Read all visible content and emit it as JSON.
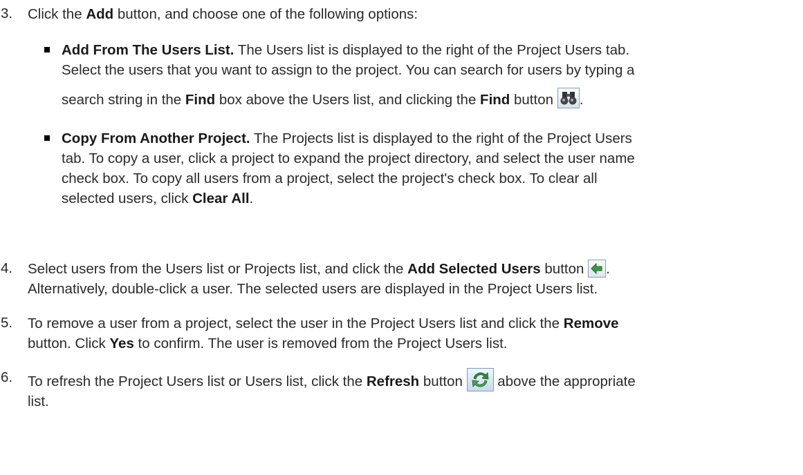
{
  "steps": [
    {
      "number": "3.",
      "intro_1": "Click the ",
      "intro_bold": "Add",
      "intro_2": " button, and choose one of the following options:",
      "options": [
        {
          "title": "Add From The Users List.",
          "line1": " The Users list is displayed to the right of the Project Users tab.",
          "line2": "Select the users that you want to assign to the project. You can search for users by typing a",
          "line3a": "search string in the ",
          "find_bold": "Find",
          "line3b": " box above the Users list, and clicking the ",
          "find_button_bold": "Find",
          "line3c": " button",
          "line3d": "."
        },
        {
          "title": "Copy From Another Project.",
          "line1": " The Projects list is displayed to the right of the Project Users",
          "line2": "tab. To copy a user, click a project to expand the project directory, and select the user name",
          "line3": "check box. To copy all users from a project, select the project's check box. To clear all",
          "line4a": "selected users, click ",
          "clear_bold": "Clear All",
          "line4b": "."
        }
      ]
    },
    {
      "number": "4.",
      "l1a": "Select users from the Users list or Projects list, and click the ",
      "l1b": "Add Selected Users",
      "l1c": " button",
      "l1d": ".",
      "l2": "Alternatively, double-click a user. The selected users are displayed in the Project Users list."
    },
    {
      "number": "5.",
      "l1a": "To remove a user from a project, select the user in the Project Users list and click the ",
      "l1b": "Remove",
      "l2a": "button. Click ",
      "l2b": "Yes",
      "l2c": " to confirm. The user is removed from the Project Users list."
    },
    {
      "number": "6.",
      "l1a": "To refresh the Project Users list or Users list, click the ",
      "l1b": "Refresh",
      "l1c": " button ",
      "l1d": " above the appropriate",
      "l2": "list."
    }
  ],
  "icons": {
    "find": "binoculars-icon",
    "add_selected": "green-arrow-left-icon",
    "refresh": "refresh-arrows-icon",
    "icon_accent": "#2e8b3a"
  }
}
